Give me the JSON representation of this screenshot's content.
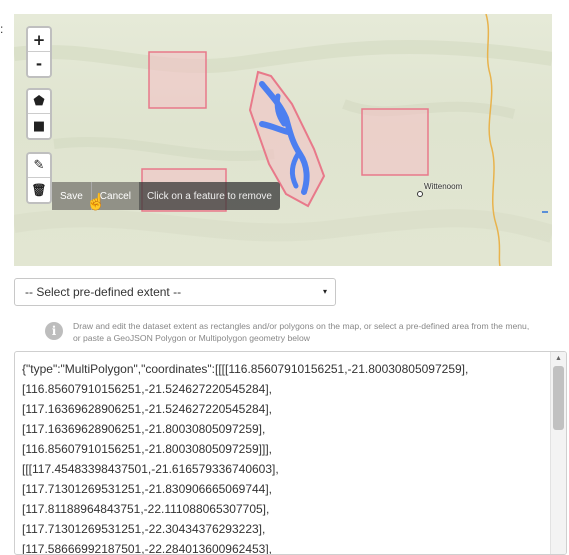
{
  "field_label": ":",
  "map": {
    "zoom_controls": [
      {
        "name": "zoom-in-button",
        "glyph": "+"
      },
      {
        "name": "zoom-out-button",
        "glyph": "-"
      }
    ],
    "draw_controls": [
      {
        "name": "draw-polygon-button",
        "icon": "pentagon-icon",
        "glyph": "⬟"
      },
      {
        "name": "draw-rectangle-button",
        "icon": "square-icon",
        "glyph": "■"
      }
    ],
    "edit_controls": [
      {
        "name": "edit-layers-button",
        "icon": "edit-icon",
        "glyph": "✎"
      },
      {
        "name": "delete-layers-button",
        "icon": "trash-icon",
        "glyph": "🗑"
      }
    ],
    "actions": {
      "save": "Save",
      "cancel": "Cancel"
    },
    "tooltip": "Click on a feature to remove",
    "place_label": "Wittenoom",
    "colors": {
      "shape_stroke": "#e8798a",
      "shape_fill": "#f4bfc4",
      "river": "#4d7ff0",
      "road": "#e8b34d"
    }
  },
  "extent_select": {
    "value": "-- Select pre-defined extent --",
    "caret": "▾"
  },
  "help": {
    "icon": "info-icon",
    "text": "Draw and edit the dataset extent as rectangles and/or polygons on the map, or select a pre-defined area from the menu, or paste a GeoJSON Polygon or Multipolygon geometry below"
  },
  "geojson_lines": [
    "{\"type\":\"MultiPolygon\",\"coordinates\":[[[[116.85607910156251,-21.80030805097259],",
    "[116.85607910156251,-21.524627220545284],",
    "[117.16369628906251,-21.524627220545284],",
    "[117.16369628906251,-21.80030805097259],",
    "[116.85607910156251,-21.80030805097259]]],",
    "[[[117.45483398437501,-21.616579336740603],",
    "[117.71301269531251,-21.8309066650697​44],",
    "[117.81188964843751,-22.111088065307705],",
    "[117.71301269531251,-22.30434376293223],",
    "[117.58666992187501,-22.284013600962453],"
  ]
}
